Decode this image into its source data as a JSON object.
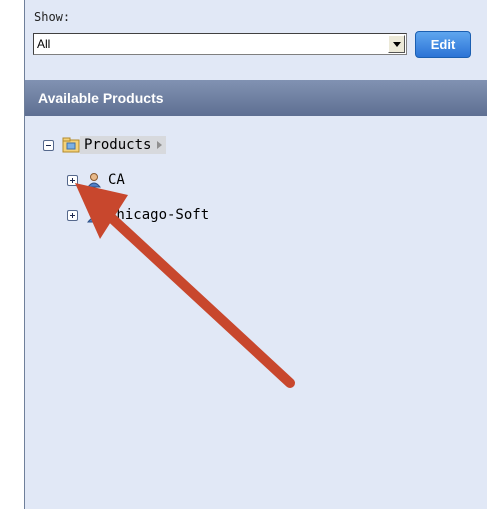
{
  "filter": {
    "label": "Show:",
    "selected": "All",
    "edit_label": "Edit"
  },
  "panel": {
    "title": "Available Products"
  },
  "tree": {
    "root": {
      "label": "Products"
    },
    "children": [
      {
        "label": "CA"
      },
      {
        "label": "Chicago-Soft"
      }
    ]
  },
  "colors": {
    "header_bg": "#6f80a2",
    "panel_bg": "#e1e8f6",
    "edit_button": "#2b73d6",
    "annotation_arrow": "#c8472d"
  }
}
